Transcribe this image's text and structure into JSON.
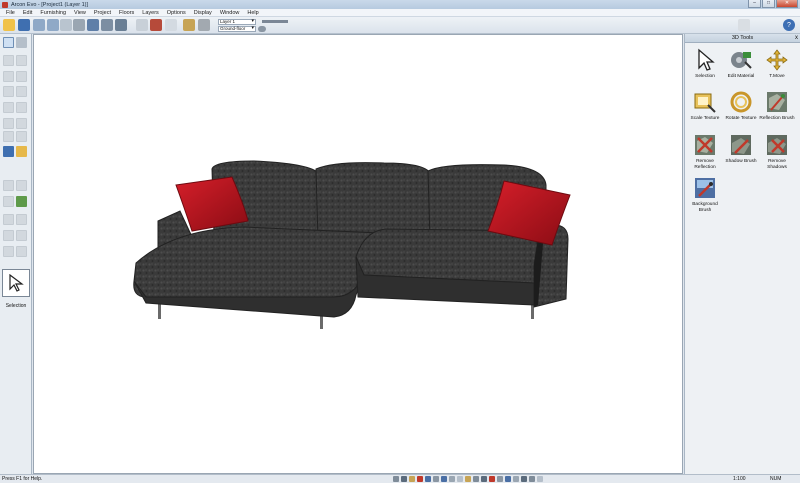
{
  "window": {
    "title": "Arcon Evo - [Project1 (Layer 1)]",
    "minimize": "–",
    "maximize": "□",
    "close": "✕"
  },
  "menu": [
    {
      "label": "File"
    },
    {
      "label": "Edit"
    },
    {
      "label": "Furnishing"
    },
    {
      "label": "View"
    },
    {
      "label": "Project"
    },
    {
      "label": "Floors"
    },
    {
      "label": "Layers"
    },
    {
      "label": "Options"
    },
    {
      "label": "Display"
    },
    {
      "label": "Window"
    },
    {
      "label": "Help"
    }
  ],
  "layer_selector": {
    "layer": "Layer 1",
    "floor": "Ground-floor"
  },
  "left_panel": {
    "active_tool_label": "Selection"
  },
  "right_panel": {
    "title": "3D Tools",
    "close": "x",
    "tools": [
      {
        "label": "Selection",
        "icon": "arrow-cursor-icon"
      },
      {
        "label": "Edit Material",
        "icon": "edit-material-icon"
      },
      {
        "label": "T.Move",
        "icon": "texture-move-icon"
      },
      {
        "label": "Scale Texture",
        "icon": "scale-texture-icon"
      },
      {
        "label": "Rotate Texture",
        "icon": "rotate-texture-icon"
      },
      {
        "label": "Reflection Brush",
        "icon": "reflection-brush-icon"
      },
      {
        "label": "Remove Reflection",
        "icon": "remove-reflection-icon"
      },
      {
        "label": "Shadow Brush",
        "icon": "shadow-brush-icon"
      },
      {
        "label": "Remove Shadows",
        "icon": "remove-shadows-icon"
      },
      {
        "label": "Background Brush",
        "icon": "background-brush-icon"
      }
    ]
  },
  "status": {
    "help_text": "Press F1 for Help.",
    "scale": "1:100",
    "num": "NUM"
  },
  "colors": {
    "sofa": "#3c3c3c",
    "cushion": "#b8121e",
    "canvas": "#ffffff",
    "accent": "#c0392b"
  }
}
